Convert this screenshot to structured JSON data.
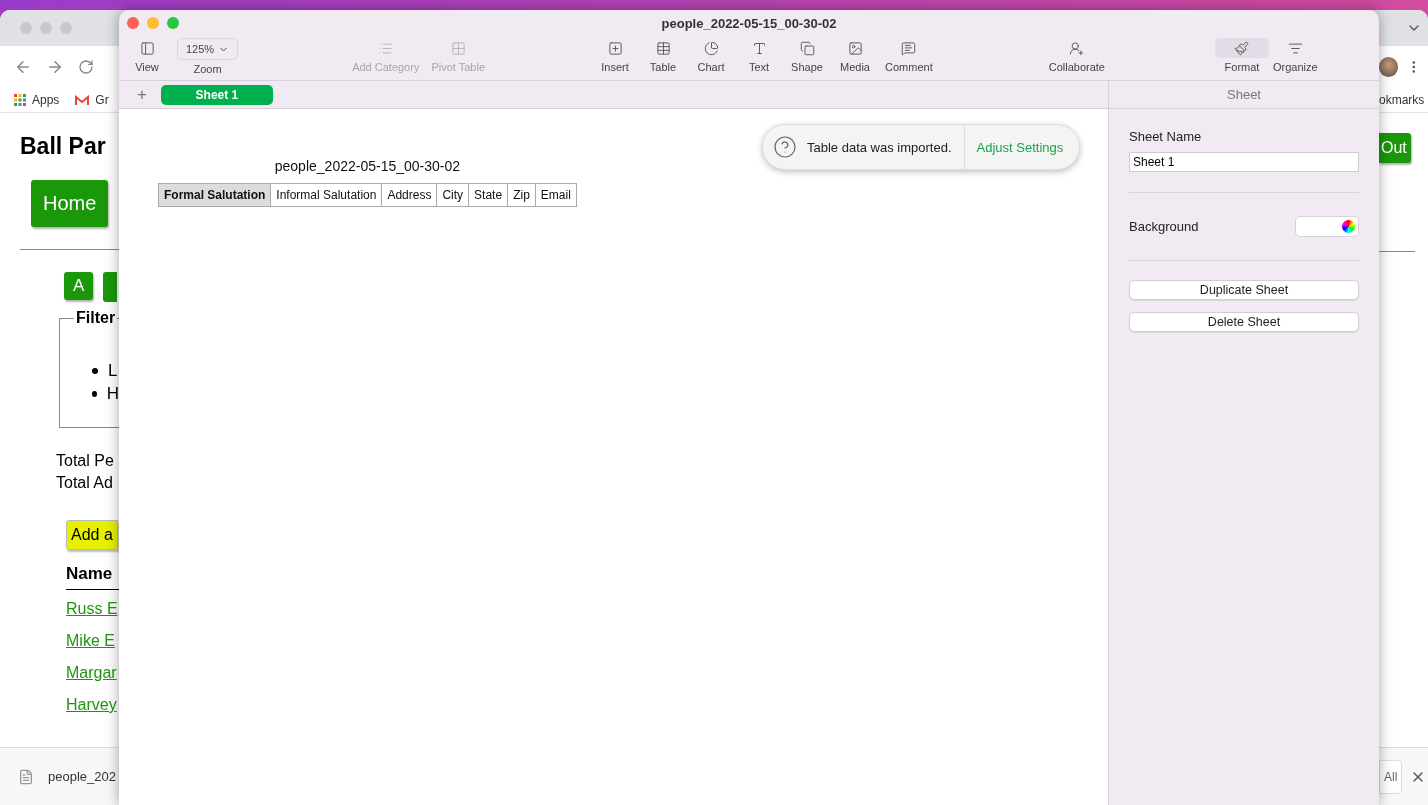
{
  "browser": {
    "bookmarks": [
      {
        "label": "Apps"
      },
      {
        "label": "Gr"
      }
    ],
    "bookmarks_more": "okmarks",
    "page": {
      "heading": "Ball Par",
      "nav_button": "Home",
      "corner_button": "Out",
      "letter_buttons": [
        "A"
      ],
      "filter": {
        "legend": "Filter",
        "items": [
          "L",
          "H"
        ]
      },
      "totals": [
        "Total Pe",
        "Total Ad"
      ],
      "add_button": "Add a",
      "column_heading": "Name",
      "links": [
        "Russ E",
        "Mike E",
        "Margar",
        "Harvey"
      ]
    },
    "downloads": {
      "file": "people_202",
      "button": "All"
    }
  },
  "numbers": {
    "window": {
      "title": "people_2022-05-15_00-30-02"
    },
    "toolbar": [
      {
        "items": [
          {
            "label": "View",
            "kind": "button",
            "disabled": false
          },
          {
            "label": "Zoom",
            "kind": "dropdown",
            "value": "125%",
            "disabled": false
          }
        ]
      },
      {
        "items": [
          {
            "label": "Add Category",
            "kind": "button",
            "disabled": true
          },
          {
            "label": "Pivot Table",
            "kind": "button",
            "disabled": true
          }
        ]
      },
      {
        "items": [
          {
            "label": "Insert",
            "kind": "button",
            "disabled": false
          },
          {
            "label": "Table",
            "kind": "button",
            "disabled": false
          },
          {
            "label": "Chart",
            "kind": "button",
            "disabled": false
          },
          {
            "label": "Text",
            "kind": "button",
            "disabled": false
          },
          {
            "label": "Shape",
            "kind": "button",
            "disabled": false
          },
          {
            "label": "Media",
            "kind": "button",
            "disabled": false
          },
          {
            "label": "Comment",
            "kind": "button",
            "disabled": false
          }
        ]
      },
      {
        "items": [
          {
            "label": "Collaborate",
            "kind": "button",
            "disabled": false
          }
        ]
      },
      {
        "items": [
          {
            "label": "Format",
            "kind": "button",
            "disabled": false,
            "selected": true
          },
          {
            "label": "Organize",
            "kind": "button",
            "disabled": false,
            "selected": false
          }
        ]
      }
    ],
    "add_sheet": "+",
    "sheets": [
      {
        "label": "Sheet 1",
        "selected": true
      }
    ],
    "toast": {
      "message": "Table data was imported.",
      "action": "Adjust Settings"
    },
    "table": {
      "title": "people_2022-05-15_00-30-02",
      "columns": [
        {
          "label": "Formal Salutation",
          "selected": true
        },
        {
          "label": "Informal Salutation",
          "selected": false
        },
        {
          "label": "Address",
          "selected": false
        },
        {
          "label": "City",
          "selected": false
        },
        {
          "label": "State",
          "selected": false
        },
        {
          "label": "Zip",
          "selected": false
        },
        {
          "label": "Email",
          "selected": false
        }
      ]
    },
    "inspector": {
      "title": "Sheet",
      "sheet_name_label": "Sheet Name",
      "sheet_name": "Sheet 1",
      "background_label": "Background",
      "buttons": [
        "Duplicate Sheet",
        "Delete Sheet"
      ]
    }
  }
}
